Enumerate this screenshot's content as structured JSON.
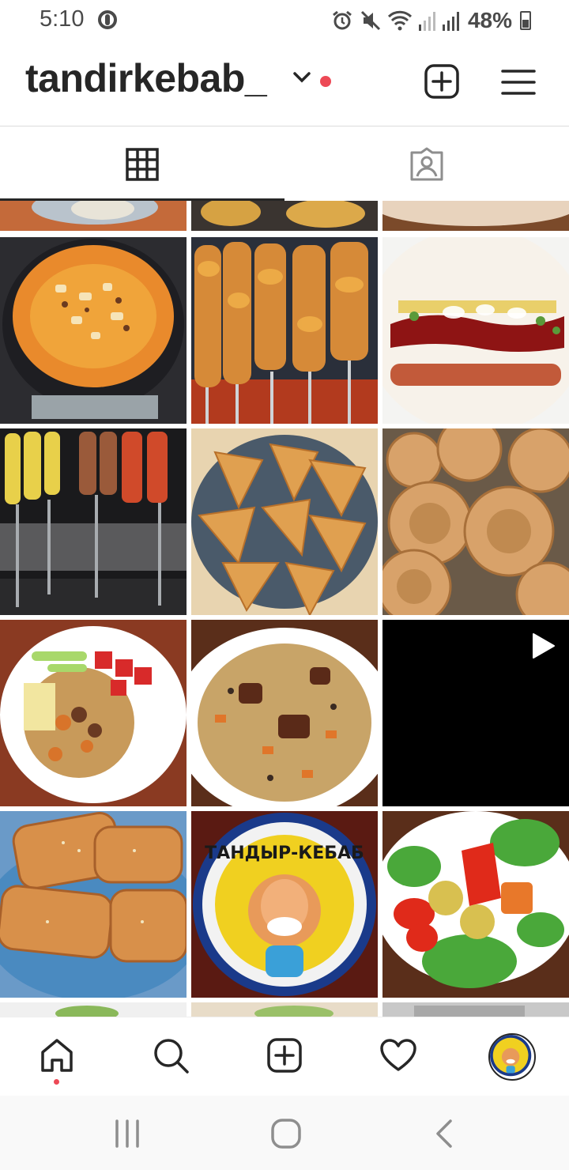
{
  "status_bar": {
    "time": "5:10",
    "battery": "48%"
  },
  "header": {
    "username": "tandirkebab_",
    "icons": [
      "chevron-down-icon",
      "notification-dot",
      "new-post-icon",
      "menu-icon"
    ]
  },
  "tabs": [
    {
      "name": "posts-grid",
      "icon": "grid-icon",
      "active": true
    },
    {
      "name": "tagged",
      "icon": "tagged-person-icon",
      "active": false
    }
  ],
  "grid": {
    "posts": [
      {
        "subject": "rice pilaf with carrots in kazan"
      },
      {
        "subject": "chicken shashlik skewers on grill"
      },
      {
        "subject": "shawarma wrap with sauce"
      },
      {
        "subject": "mixed kebab skewers over coals"
      },
      {
        "subject": "baked samsa pastries"
      },
      {
        "subject": "tandir non flatbread"
      },
      {
        "subject": "plov plate with salad"
      },
      {
        "subject": "plov with beef and raisins"
      },
      {
        "subject": "video post",
        "is_video": true
      },
      {
        "subject": "samsa on blue plate"
      },
      {
        "subject": "Tandyr-Kebab logo plate"
      },
      {
        "subject": "grilled vegetables with greens"
      }
    ],
    "logo_text": "ТАНДЫР-КЕБАБ"
  },
  "bottom_nav": {
    "items": [
      "home-icon",
      "search-icon",
      "new-post-icon",
      "activity-heart-icon",
      "profile-avatar"
    ]
  },
  "colors": {
    "notification": "#ed4956",
    "text": "#262626",
    "divider": "#dbdbdb"
  }
}
